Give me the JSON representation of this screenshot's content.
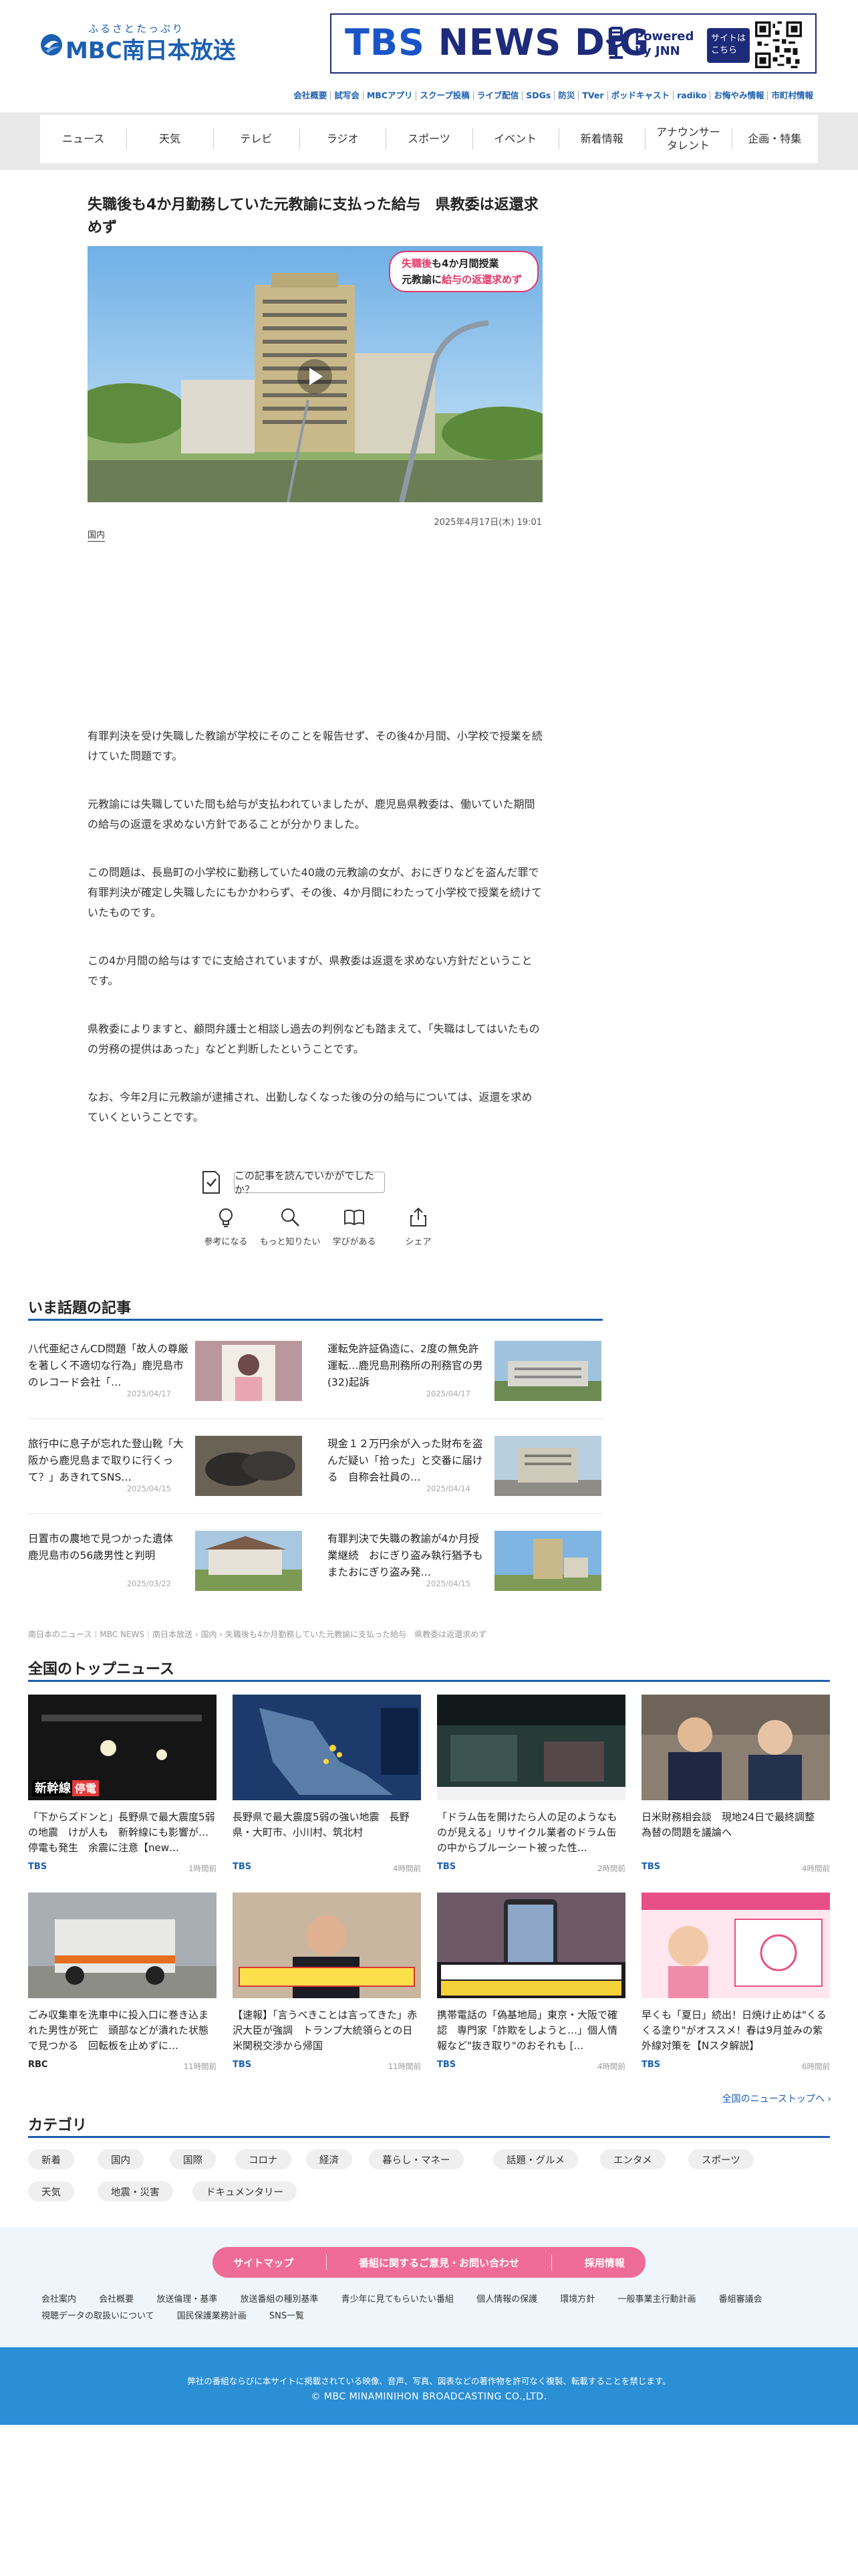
{
  "header": {
    "logo_ruby": "ふるさとたっぷり",
    "logo_text": "MBC南日本放送",
    "banner": {
      "title_tbs": "TBS",
      "title_rest": " NEWS DIG",
      "powered": "Powered\nby JNN",
      "site": "サイトは\nこちら"
    }
  },
  "util_links": [
    "会社概要",
    "試写会",
    "MBCアプリ",
    "スクープ投稿",
    "ライブ配信",
    "SDGs",
    "防災",
    "TVer",
    "ポッドキャスト",
    "radiko",
    "お悔やみ情報",
    "市町村情報"
  ],
  "nav": [
    "ニュース",
    "天気",
    "テレビ",
    "ラジオ",
    "スポーツ",
    "イベント",
    "新着情報",
    "アナウンサー\nタレント",
    "企画・特集"
  ],
  "article": {
    "title": "失職後も4か月勤務していた元教諭に支払った給与　県教委は返還求めず",
    "image_caption_line1_a": "失職後",
    "image_caption_line1_b": "も4か月間授業",
    "image_caption_line2_a": "元教諭に",
    "image_caption_line2_b": "給与の返還求めず",
    "date": "2025年4月17日(木) 19:01",
    "category": "国内",
    "paragraphs": [
      "有罪判決を受け失職した教諭が学校にそのことを報告せず、その後4か月間、小学校で授業を続けていた問題です。",
      "元教諭には失職していた間も給与が支払われていましたが、鹿児島県教委は、働いていた期間の給与の返還を求めない方針であることが分かりました。",
      "この問題は、長島町の小学校に勤務していた40歳の元教諭の女が、おにぎりなどを盗んだ罪で有罪判決が確定し失職したにもかかわらず、その後、4か月間にわたって小学校で授業を続けていたものです。",
      "この4か月間の給与はすでに支給されていますが、県教委は返還を求めない方針だということです。",
      "県教委によりますと、顧問弁護士と相談し過去の判例なども踏まえて、「失職はしてはいたものの労務の提供はあった」などと判断したということです。",
      "なお、今年2月に元教諭が逮捕され、出勤しなくなった後の分の給与については、返還を求めていくということです。"
    ],
    "feedback_question": "この記事を読んでいかがでしたか？",
    "reactions": [
      "参考になる",
      "もっと知りたい",
      "学びがある",
      "シェア"
    ]
  },
  "trending": {
    "title": "いま話題の記事",
    "items": [
      {
        "text": "八代亜紀さんCD問題「故人の尊厳を著しく不適切な行為」鹿児島市のレコード会社「…",
        "date": "2025/04/17",
        "thumb": "portrait"
      },
      {
        "text": "運転免許証偽造に、2度の無免許運転…鹿児島刑務所の刑務官の男(32)起訴",
        "date": "2025/04/17",
        "thumb": "building"
      },
      {
        "text": "旅行中に息子が忘れた登山靴「大阪から鹿児島まで取りに行くって？」あきれてSNS…",
        "date": "2025/04/15",
        "thumb": "shoes"
      },
      {
        "text": "現金１２万円余が入った財布を盗んだ疑い「拾った」と交番に届ける　自称会社員の…",
        "date": "2025/04/14",
        "thumb": "station"
      },
      {
        "text": "日置市の農地で見つかった遺体　鹿児島市の56歳男性と判明",
        "date": "2025/03/22",
        "thumb": "house"
      },
      {
        "text": "有罪判決で失職の教諭が4か月授業継続　おにぎり盗み執行猶予もまたおにぎり盗み発…",
        "date": "2025/04/15",
        "thumb": "tower"
      }
    ]
  },
  "breadcrumb": "南日本のニュース｜MBC NEWS｜南日本放送 › 国内 › 失職後も4か月勤務していた元教諭に支払った給与　県教委は返還求めず",
  "national": {
    "title": "全国のトップニュース",
    "items": [
      {
        "text": "「下からズドンと」長野県で最大震度5弱の地震　けが人も　新幹線にも影響が…停電も発生　余震に注意【new…",
        "src": "TBS",
        "time": "1時間前",
        "thumb": "dark-station"
      },
      {
        "text": "長野県で最大震度5弱の強い地震　長野県・大町市、小川村、筑北村",
        "src": "TBS",
        "time": "4時間前",
        "thumb": "map"
      },
      {
        "text": "「ドラム缶を開けたら人の足のようなものが見える」リサイクル業者のドラム缶の中からブルーシート被った性…",
        "src": "TBS",
        "time": "2時間前",
        "thumb": "night"
      },
      {
        "text": "日米財務相会談　現地24日で最終調整　為替の問題を議論へ",
        "src": "TBS",
        "time": "4時間前",
        "thumb": "officials"
      },
      {
        "text": "ごみ収集車を洗車中に投入口に巻き込まれた男性が死亡　頭部などが潰れた状態で見つかる　回転板を止めずに…",
        "src": "RBC",
        "time": "11時間前",
        "thumb": "truck"
      },
      {
        "text": "【速報】「言うべきことは言ってきた」赤沢大臣が強調　トランプ大統領らとの日米関税交渉から帰国",
        "src": "TBS",
        "time": "11時間前",
        "thumb": "minister"
      },
      {
        "text": "携帯電話の「偽基地局」東京・大阪で確認　専門家「詐欺をしようと…」個人情報など\"抜き取り\"のおそれも […",
        "src": "TBS",
        "time": "4時間前",
        "thumb": "phone"
      },
      {
        "text": "早くも「夏日」続出！日焼け止めは\"くるくる塗り\"がオススメ！春は9月並みの紫外線対策を【Nスタ解説】",
        "src": "TBS",
        "time": "6時間前",
        "thumb": "sunscreen"
      }
    ],
    "more": "全国のニューストップへ ›"
  },
  "categories": {
    "title": "カテゴリ",
    "items": [
      "新着",
      "国内",
      "国際",
      "コロナ",
      "経済",
      "暮らし・マネー",
      "話題・グルメ",
      "エンタメ",
      "スポーツ",
      "天気",
      "地震・災害",
      "ドキュメンタリー"
    ]
  },
  "footer": {
    "pills": [
      "サイトマップ",
      "番組に関するご意見・お問い合わせ",
      "採用情報"
    ],
    "links": [
      "会社案内",
      "会社概要",
      "放送倫理・基準",
      "放送番組の種別基準",
      "青少年に見てもらいたい番組",
      "個人情報の保護",
      "環境方針",
      "一般事業主行動計画",
      "番組審議会",
      "視聴データの取扱いについて",
      "国民保護業務計画",
      "SNS一覧"
    ],
    "note": "弊社の番組ならびに本サイトに掲載されている映像、音声、写真、図表などの著作物を許可なく複製、転載することを禁じます。",
    "copyright": "© MBC MINAMINIHON BROADCASTING CO.,LTD."
  }
}
